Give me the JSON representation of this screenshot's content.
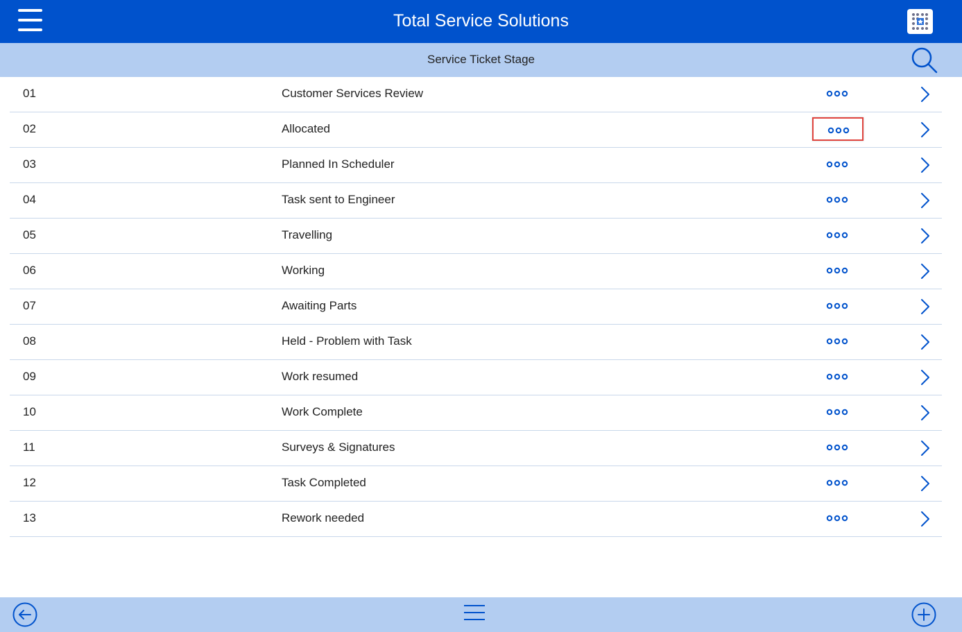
{
  "header": {
    "app_title": "Total Service Solutions",
    "menu_icon": "hamburger-menu-icon",
    "logo_icon": "app-logo-icon"
  },
  "subheader": {
    "title": "Service Ticket Stage",
    "search_icon": "search-icon"
  },
  "rows": [
    {
      "num": "01",
      "label": "Customer Services Review"
    },
    {
      "num": "02",
      "label": "Allocated",
      "selected": true
    },
    {
      "num": "03",
      "label": "Planned In Scheduler"
    },
    {
      "num": "04",
      "label": "Task sent to Engineer"
    },
    {
      "num": "05",
      "label": "Travelling"
    },
    {
      "num": "06",
      "label": "Working"
    },
    {
      "num": "07",
      "label": "Awaiting Parts"
    },
    {
      "num": "08",
      "label": "Held - Problem with Task"
    },
    {
      "num": "09",
      "label": "Work resumed"
    },
    {
      "num": "10",
      "label": "Work Complete"
    },
    {
      "num": "11",
      "label": "Surveys & Signatures"
    },
    {
      "num": "12",
      "label": "Task Completed"
    },
    {
      "num": "13",
      "label": "Rework needed"
    }
  ],
  "row_icons": {
    "more": "more-options-icon",
    "open": "chevron-right-icon"
  },
  "footer": {
    "back_icon": "back-arrow-icon",
    "menu_icon": "list-menu-icon",
    "add_icon": "add-icon"
  },
  "colors": {
    "primary": "#0052cc",
    "subbar": "#b3cdf1",
    "highlight_border": "#e0443e",
    "divider": "#c8d7ea"
  }
}
